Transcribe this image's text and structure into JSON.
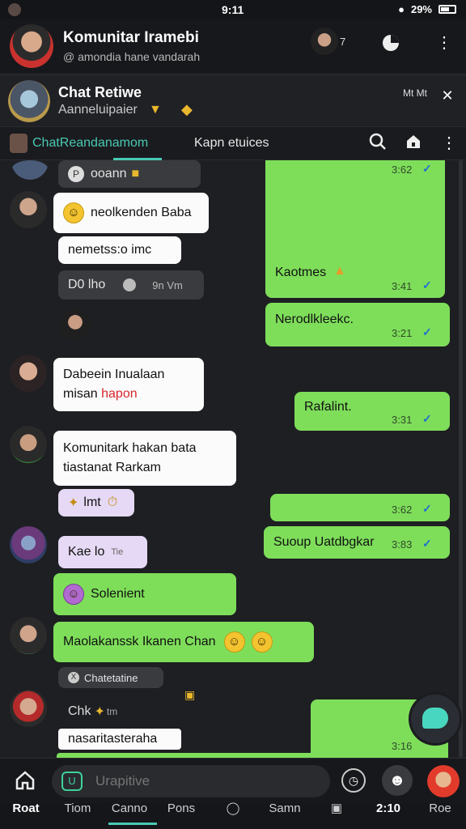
{
  "status": {
    "time": "9:11",
    "battery": "29%"
  },
  "header1": {
    "title": "Komunitar Iramebi",
    "subtitle": "@ amondia hane vandarah",
    "count": "7"
  },
  "header2": {
    "title": "Chat Retiwe",
    "subtitle": "Aanneluipaier",
    "right_label": "Mt Mt"
  },
  "tabs": {
    "tab1": "ChatReandanamom",
    "tab2": "Kapn etuices"
  },
  "messages": [
    {
      "id": "m0",
      "text": "ooann",
      "time": "3:62"
    },
    {
      "id": "m1",
      "text": "neolkenden Baba"
    },
    {
      "id": "m2",
      "text": "nemetss:o imc"
    },
    {
      "id": "m3",
      "text": "D0 lho",
      "time": "9n Vm"
    },
    {
      "id": "m4",
      "text": "Kaotmes",
      "time": "3:41"
    },
    {
      "id": "m5",
      "text": "Nerodlkleekc.",
      "time": "3:21"
    },
    {
      "id": "m6",
      "line1": "Dabeein Inualaan",
      "line2a": "misan ",
      "line2b": "hapon"
    },
    {
      "id": "m7",
      "text": "Rafalint.",
      "time": "3:31"
    },
    {
      "id": "m8",
      "line1": "Komunitark hakan bata",
      "line2": "tiastanat Rarkam"
    },
    {
      "id": "m9",
      "text": "lmt"
    },
    {
      "id": "m10",
      "time": "3:62"
    },
    {
      "id": "m11",
      "text": "Suoup Uatdbgkar",
      "time": "3:83"
    },
    {
      "id": "m12",
      "text": "Kae lo",
      "suffix": "Tie"
    },
    {
      "id": "m13",
      "text": "Solenient"
    },
    {
      "id": "m14",
      "text": "Maolakanssk Ikanen Chan"
    },
    {
      "id": "m15",
      "text": "Chatetatine"
    },
    {
      "id": "m16",
      "text": "Chk",
      "suffix": "tm"
    },
    {
      "id": "m17",
      "text": "nasaritasteraha"
    },
    {
      "id": "m18",
      "time": "3:16"
    }
  ],
  "composer": {
    "placeholder": "Urapitive"
  },
  "nav": [
    "Roat",
    "Tiom",
    "Canno",
    "Pons",
    "",
    "Samn",
    "",
    "2:10",
    "Roe"
  ],
  "colors": {
    "accent": "#49c9b4",
    "outgoing": "#7ede5a",
    "incoming": "#fbfbfb",
    "tick": "#1f6fd0"
  }
}
